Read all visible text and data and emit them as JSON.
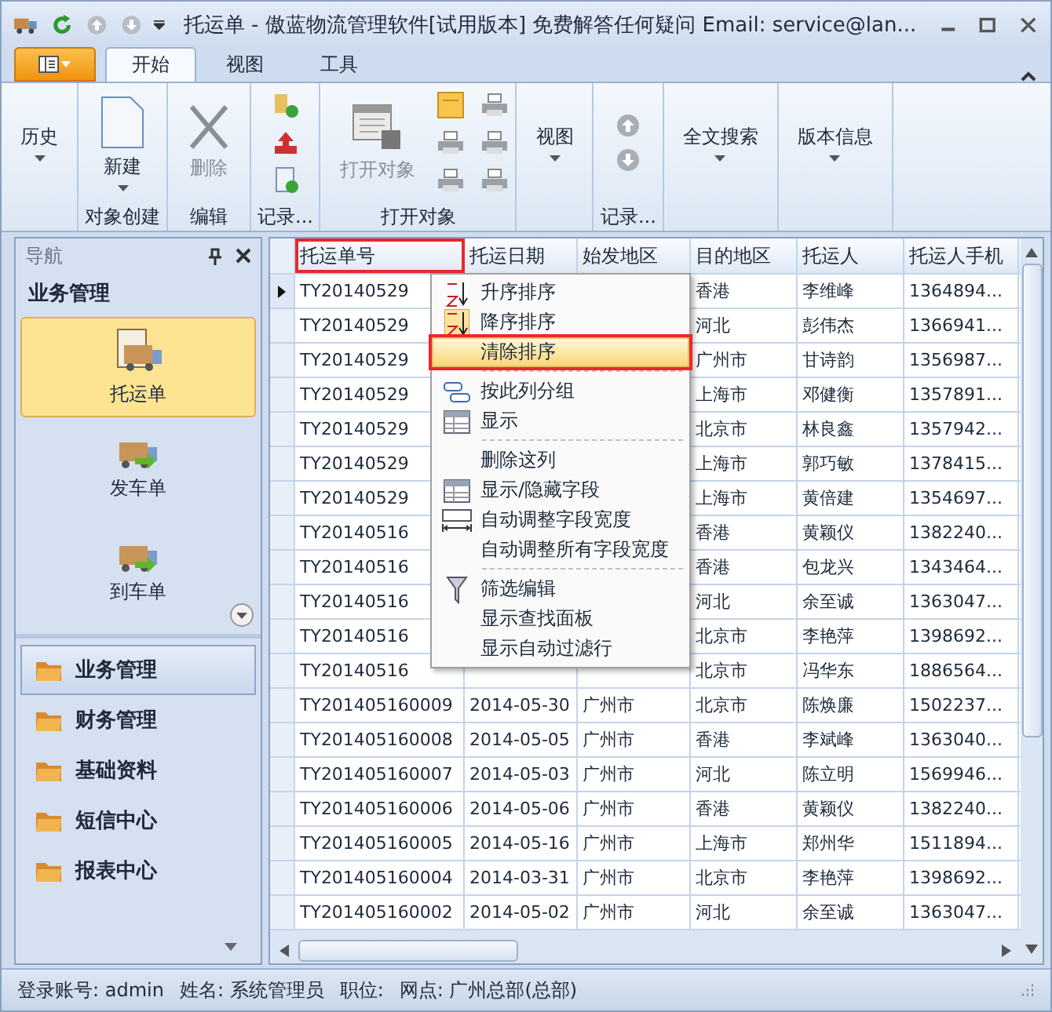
{
  "window": {
    "title": "托运单 - 傲蓝物流管理软件[试用版本] 免费解答任何疑问 Email: service@lan..."
  },
  "tabs": [
    {
      "label": "开始",
      "selected": true
    },
    {
      "label": "视图",
      "selected": false
    },
    {
      "label": "工具",
      "selected": false
    }
  ],
  "ribbon": [
    {
      "kind": "dropdown",
      "label": "历史"
    },
    {
      "kind": "new",
      "label": "新建",
      "group": "对象创建"
    },
    {
      "kind": "delete",
      "label": "删除",
      "disabled": true,
      "group": "编辑"
    },
    {
      "kind": "icons",
      "group": "记录..."
    },
    {
      "kind": "open",
      "label": "打开对象",
      "disabled": true,
      "group": "打开对象"
    },
    {
      "kind": "dropdown",
      "label": "视图"
    },
    {
      "kind": "arrows",
      "group": "记录..."
    },
    {
      "kind": "dropdown",
      "label": "全文搜索"
    },
    {
      "kind": "dropdown",
      "label": "版本信息"
    }
  ],
  "nav": {
    "title": "导航",
    "section": "业务管理",
    "items": [
      {
        "label": "托运单",
        "selected": true
      },
      {
        "label": "发车单",
        "selected": false
      },
      {
        "label": "到车单",
        "selected": false
      }
    ],
    "groups": [
      {
        "label": "业务管理",
        "selected": true
      },
      {
        "label": "财务管理",
        "selected": false
      },
      {
        "label": "基础资料",
        "selected": false
      },
      {
        "label": "短信中心",
        "selected": false
      },
      {
        "label": "报表中心",
        "selected": false
      }
    ]
  },
  "table": {
    "columns": [
      {
        "label": "托运单号",
        "marked": true
      },
      {
        "label": "托运日期",
        "marked": false
      },
      {
        "label": "始发地区",
        "marked": false
      },
      {
        "label": "目的地区",
        "marked": false
      },
      {
        "label": "托运人",
        "marked": false
      },
      {
        "label": "托运人手机",
        "marked": false
      }
    ],
    "rows": [
      {
        "current": true,
        "id": "TY20140529",
        "destination": "香港",
        "shipper": "李维峰",
        "phone": "1364894..."
      },
      {
        "current": false,
        "id": "TY20140529",
        "destination": "河北",
        "shipper": "彭伟杰",
        "phone": "1366941..."
      },
      {
        "current": false,
        "id": "TY20140529",
        "destination": "广州市",
        "shipper": "甘诗韵",
        "phone": "1356987..."
      },
      {
        "current": false,
        "id": "TY20140529",
        "destination": "上海市",
        "shipper": "邓健衡",
        "phone": "1357891..."
      },
      {
        "current": false,
        "id": "TY20140529",
        "destination": "北京市",
        "shipper": "林良鑫",
        "phone": "1357942..."
      },
      {
        "current": false,
        "id": "TY20140529",
        "destination": "上海市",
        "shipper": "郭巧敏",
        "phone": "1378415..."
      },
      {
        "current": false,
        "id": "TY20140529",
        "destination": "上海市",
        "shipper": "黄倍建",
        "phone": "1354697..."
      },
      {
        "current": false,
        "id": "TY20140516",
        "destination": "香港",
        "shipper": "黄颖仪",
        "phone": "1382240..."
      },
      {
        "current": false,
        "id": "TY20140516",
        "destination": "香港",
        "shipper": "包龙兴",
        "phone": "1343464..."
      },
      {
        "current": false,
        "id": "TY20140516",
        "destination": "河北",
        "shipper": "余至诚",
        "phone": "1363047..."
      },
      {
        "current": false,
        "id": "TY20140516",
        "destination": "北京市",
        "shipper": "李艳萍",
        "phone": "1398692..."
      },
      {
        "current": false,
        "id": "TY20140516",
        "destination": "北京市",
        "shipper": "冯华东",
        "phone": "1886564..."
      },
      {
        "current": false,
        "id": "TY201405160009",
        "date": "2014-05-30",
        "origin": "广州市",
        "destination": "北京市",
        "shipper": "陈焕廉",
        "phone": "1502237..."
      },
      {
        "current": false,
        "id": "TY201405160008",
        "date": "2014-05-05",
        "origin": "广州市",
        "destination": "香港",
        "shipper": "李斌峰",
        "phone": "1363040..."
      },
      {
        "current": false,
        "id": "TY201405160007",
        "date": "2014-05-03",
        "origin": "广州市",
        "destination": "河北",
        "shipper": "陈立明",
        "phone": "1569946..."
      },
      {
        "current": false,
        "id": "TY201405160006",
        "date": "2014-05-06",
        "origin": "广州市",
        "destination": "香港",
        "shipper": "黄颖仪",
        "phone": "1382240..."
      },
      {
        "current": false,
        "id": "TY201405160005",
        "date": "2014-05-16",
        "origin": "广州市",
        "destination": "上海市",
        "shipper": "郑州华",
        "phone": "1511894..."
      },
      {
        "current": false,
        "id": "TY201405160004",
        "date": "2014-03-31",
        "origin": "广州市",
        "destination": "北京市",
        "shipper": "李艳萍",
        "phone": "1398692..."
      },
      {
        "current": false,
        "id": "TY201405160002",
        "date": "2014-05-02",
        "origin": "广州市",
        "destination": "河北",
        "shipper": "余至诚",
        "phone": "1363047..."
      }
    ]
  },
  "context_menu": {
    "items": [
      {
        "kind": "sort-asc",
        "label": "升序排序",
        "selected": false,
        "marked": false
      },
      {
        "kind": "sort-desc",
        "label": "降序排序",
        "selected": false,
        "marked": false
      },
      {
        "kind": "plain",
        "label": "清除排序",
        "selected": true,
        "marked": true
      },
      {
        "kind": "separator"
      },
      {
        "kind": "group",
        "label": "按此列分组",
        "selected": false,
        "marked": false
      },
      {
        "kind": "show",
        "label": "显示",
        "selected": false,
        "marked": false
      },
      {
        "kind": "separator"
      },
      {
        "kind": "plain",
        "label": "删除这列",
        "selected": false,
        "marked": false
      },
      {
        "kind": "fields",
        "label": "显示/隐藏字段",
        "selected": false,
        "marked": false
      },
      {
        "kind": "width",
        "label": "自动调整字段宽度",
        "selected": false,
        "marked": false
      },
      {
        "kind": "plain",
        "label": "自动调整所有字段宽度",
        "selected": false,
        "marked": false
      },
      {
        "kind": "separator"
      },
      {
        "kind": "filter",
        "label": "筛选编辑",
        "selected": false,
        "marked": false
      },
      {
        "kind": "plain",
        "label": "显示查找面板",
        "selected": false,
        "marked": false
      },
      {
        "kind": "plain",
        "label": "显示自动过滤行",
        "selected": false,
        "marked": false
      }
    ]
  },
  "status_bar": [
    "登录账号: admin",
    "姓名: 系统管理员",
    "职位:",
    "网点: 广州总部(总部)"
  ]
}
